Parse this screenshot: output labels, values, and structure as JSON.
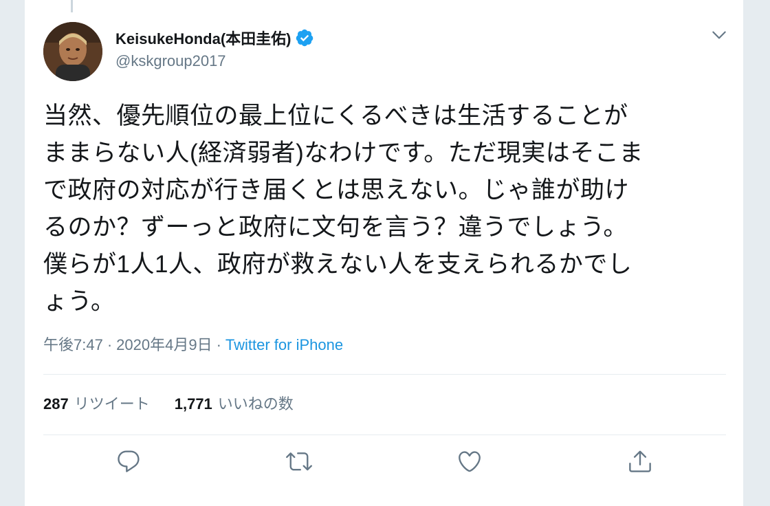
{
  "tweet": {
    "author": {
      "display_name": "KeisukeHonda(本田圭佑)",
      "handle": "@kskgroup2017",
      "verified": true
    },
    "text_lines": [
      "当然、優先順位の最上位にくるべきは生活することが",
      "ままらない人(経済弱者)なわけです。ただ現実はそこま",
      "で政府の対応が行き届くとは思えない。じゃ誰が助け",
      "るのか？ずーっと政府に文句を言う？違うでしょう。",
      "僕らが1人1人、政府が救えない人を支えられるかでし",
      "ょう。"
    ],
    "time": "午後7:47",
    "separator": "·",
    "date": "2020年4月9日",
    "source": "Twitter for iPhone",
    "retweet_count": "287",
    "retweet_label": "リツイート",
    "like_count": "1,771",
    "like_label": "いいねの数"
  },
  "icons": {
    "reply": "reply-icon",
    "retweet": "retweet-icon",
    "like": "heart-icon",
    "share": "share-icon",
    "caret": "chevron-down-icon",
    "verified": "verified-badge-icon"
  },
  "colors": {
    "text": "#14171a",
    "secondary": "#657786",
    "link": "#1b95e0",
    "verified": "#1da1f2",
    "border": "#e6ecf0"
  }
}
